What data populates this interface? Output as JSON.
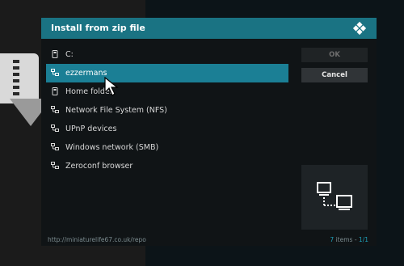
{
  "dialog": {
    "title": "Install from zip file"
  },
  "items": [
    {
      "label": "C:",
      "icon": "drive-icon"
    },
    {
      "label": "ezzermans",
      "icon": "network-icon",
      "selected": true
    },
    {
      "label": "Home folder",
      "icon": "drive-icon"
    },
    {
      "label": "Network File System (NFS)",
      "icon": "network-icon"
    },
    {
      "label": "UPnP devices",
      "icon": "network-icon"
    },
    {
      "label": "Windows network (SMB)",
      "icon": "network-icon"
    },
    {
      "label": "Zeroconf browser",
      "icon": "network-icon"
    }
  ],
  "buttons": {
    "ok": "OK",
    "cancel": "Cancel"
  },
  "footer": {
    "path": "http://miniaturelife67.co.uk/repo",
    "count": "7",
    "count_suffix": " items - ",
    "page": "1/1"
  },
  "colors": {
    "accent": "#1a7383",
    "selected": "#1b7f95"
  }
}
